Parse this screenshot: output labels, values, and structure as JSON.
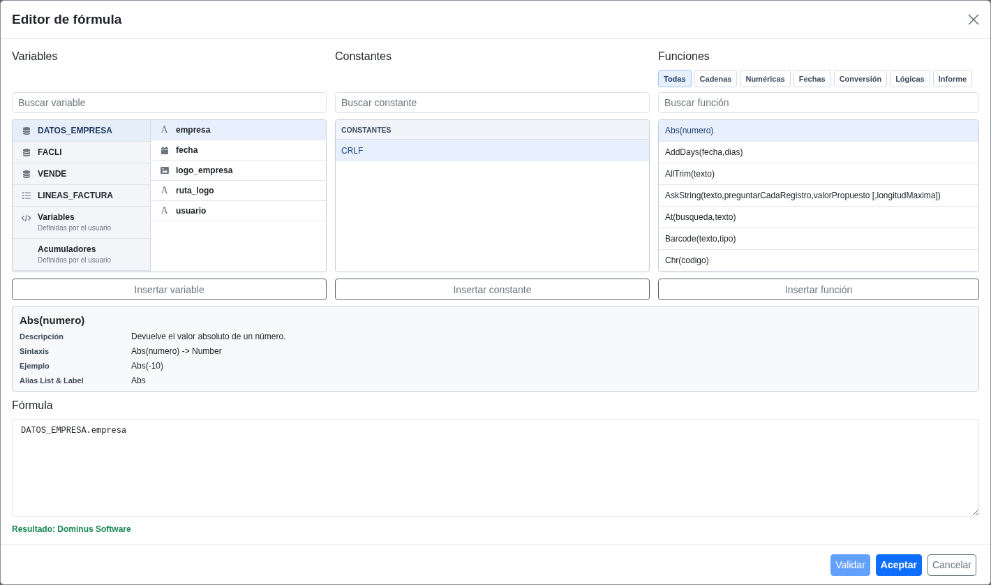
{
  "dialog": {
    "title": "Editor de fórmula"
  },
  "variables": {
    "heading": "Variables",
    "search": {
      "placeholder": "Buscar variable"
    },
    "sources": [
      {
        "label": "DATOS_EMPRESA",
        "kind": "table",
        "selected": true
      },
      {
        "label": "FACLI",
        "kind": "table",
        "selected": false
      },
      {
        "label": "VENDE",
        "kind": "table",
        "selected": false
      },
      {
        "label": "LINEAS_FACTURA",
        "kind": "list",
        "selected": false
      },
      {
        "label": "Variables",
        "subtitle": "Definidas por el usuario",
        "kind": "code",
        "selected": false
      },
      {
        "label": "Acumuladores",
        "subtitle": "Definidos por el usuario",
        "kind": "plain",
        "selected": false
      }
    ],
    "fields": [
      {
        "name": "empresa",
        "kind": "text",
        "glyph": "A",
        "selected": true
      },
      {
        "name": "fecha",
        "kind": "date",
        "selected": false
      },
      {
        "name": "logo_empresa",
        "kind": "image",
        "selected": false
      },
      {
        "name": "ruta_logo",
        "kind": "text",
        "glyph": "A",
        "selected": false
      },
      {
        "name": "usuario",
        "kind": "text",
        "glyph": "A",
        "selected": false
      }
    ],
    "insert_button": "Insertar variable"
  },
  "constants": {
    "heading": "Constantes",
    "search": {
      "placeholder": "Buscar constante"
    },
    "group": "CONSTANTES",
    "items": [
      {
        "label": "CRLF",
        "selected": true
      }
    ],
    "insert_button": "Insertar constante"
  },
  "functions": {
    "heading": "Funciones",
    "tabs": [
      {
        "label": "Todas",
        "selected": true
      },
      {
        "label": "Cadenas",
        "selected": false
      },
      {
        "label": "Numéricas",
        "selected": false
      },
      {
        "label": "Fechas",
        "selected": false
      },
      {
        "label": "Conversión",
        "selected": false
      },
      {
        "label": "Lógicas",
        "selected": false
      },
      {
        "label": "Informe",
        "selected": false
      }
    ],
    "search": {
      "placeholder": "Buscar función"
    },
    "items": [
      {
        "label": "Abs(numero)",
        "selected": true
      },
      {
        "label": "AddDays(fecha,dias)",
        "selected": false
      },
      {
        "label": "AllTrim(texto)",
        "selected": false
      },
      {
        "label": "AskString(texto,preguntarCadaRegistro,valorPropuesto [,longitudMaxima])",
        "selected": false
      },
      {
        "label": "At(busqueda,texto)",
        "selected": false
      },
      {
        "label": "Barcode(texto,tipo)",
        "selected": false
      },
      {
        "label": "Chr(codigo)",
        "selected": false
      }
    ],
    "insert_button": "Insertar función"
  },
  "details": {
    "title": "Abs(numero)",
    "rows": [
      {
        "label": "Descripción",
        "value": "Devuelve el valor absoluto de un número."
      },
      {
        "label": "Sintaxis",
        "value": "Abs(numero) -> Number"
      },
      {
        "label": "Ejemplo",
        "value": "Abs(-10)"
      },
      {
        "label": "Alias List & Label",
        "value": "Abs"
      }
    ]
  },
  "formula": {
    "label": "Fórmula",
    "value": "DATOS_EMPRESA.empresa",
    "result": "Resultado: Dominus Software"
  },
  "buttons": [
    {
      "label": "Validar",
      "kind": "primary",
      "disabled": true
    },
    {
      "label": "Aceptar",
      "kind": "primary",
      "disabled": false
    },
    {
      "label": "Cancelar",
      "kind": "outline",
      "disabled": false
    }
  ]
}
